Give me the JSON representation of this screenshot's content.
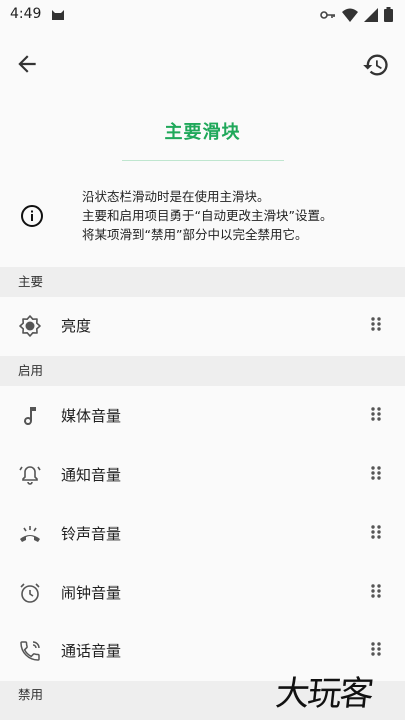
{
  "status_bar": {
    "time": "4:49"
  },
  "app_bar": {
    "back_icon": "arrow-back-icon",
    "restore_icon": "restore-icon"
  },
  "page": {
    "title": "主要滑块"
  },
  "info": {
    "icon": "info-icon",
    "lines": [
      "沿状态栏滑动时是在使用主滑块。",
      "主要和启用项目勇于“自动更改主滑块”设置。",
      "将某项滑到“禁用”部分中以完全禁用它。"
    ]
  },
  "sections": {
    "primary": "主要",
    "enabled": "启用",
    "disabled": "禁用"
  },
  "items": {
    "brightness": "亮度",
    "media": "媒体音量",
    "notification": "通知音量",
    "ringtone": "铃声音量",
    "alarm": "闹钟音量",
    "call": "通话音量"
  },
  "watermark": "大玩客",
  "colors": {
    "accent": "#1fa85a",
    "section_bg": "#eeeeee",
    "background": "#fafafa"
  }
}
